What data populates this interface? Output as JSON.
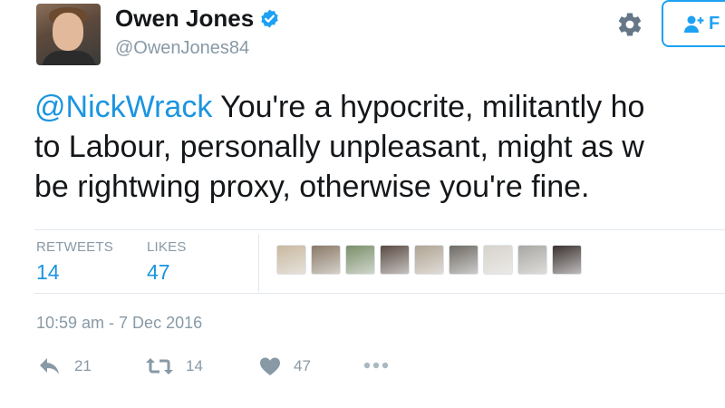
{
  "user": {
    "name": "Owen Jones",
    "handle": "@OwenJones84"
  },
  "follow_button": {
    "label": "F"
  },
  "tweet": {
    "mention": "@NickWrack",
    "line1_rest": " You're a hypocrite, militantly ho",
    "line2": "to Labour, personally unpleasant, might as w",
    "line3": "be rightwing proxy, otherwise you're fine."
  },
  "stats": {
    "retweets_label": "RETWEETS",
    "retweets_value": "14",
    "likes_label": "LIKES",
    "likes_value": "47"
  },
  "likers": [
    {
      "name": "liker-avatar",
      "color": "#c9b8a0"
    },
    {
      "name": "liker-avatar",
      "color": "#8a7a66"
    },
    {
      "name": "liker-avatar",
      "color": "#7a8f6a"
    },
    {
      "name": "liker-avatar",
      "color": "#5a4a42"
    },
    {
      "name": "liker-avatar",
      "color": "#b0a493"
    },
    {
      "name": "liker-avatar",
      "color": "#6e6a64"
    },
    {
      "name": "liker-avatar",
      "color": "#d7d3cc"
    },
    {
      "name": "liker-avatar",
      "color": "#a9a7a2"
    },
    {
      "name": "liker-avatar",
      "color": "#3a3230"
    }
  ],
  "timestamp": "10:59 am - 7 Dec 2016",
  "actions": {
    "reply_count": "21",
    "retweet_count": "14",
    "like_count": "47"
  },
  "colors": {
    "accent": "#1da1f2",
    "link": "#1b95e0",
    "muted": "#8899a6",
    "divider": "#e1e8ed"
  }
}
